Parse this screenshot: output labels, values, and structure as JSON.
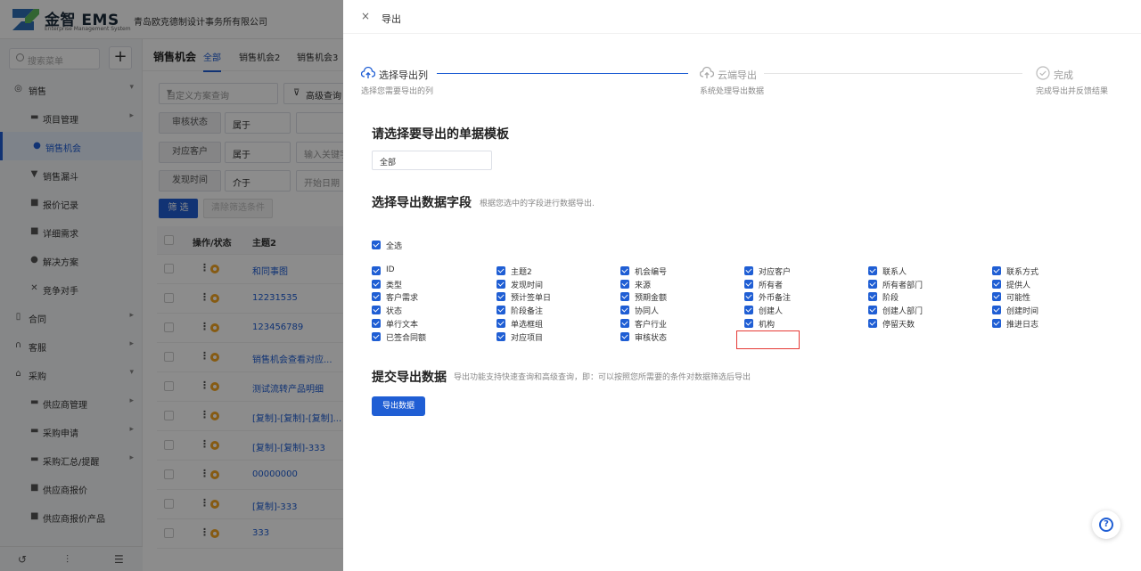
{
  "app": {
    "brand": "金智 EMS",
    "brand_sub": "Enterprise Management System",
    "company": "青岛欧克德制设计事务所有限公司"
  },
  "sidebar": {
    "search_placeholder": "搜索菜单",
    "plus": "+",
    "items": [
      {
        "label": "销售"
      },
      {
        "label": "项目管理"
      },
      {
        "label": "销售机会"
      },
      {
        "label": "销售漏斗"
      },
      {
        "label": "报价记录"
      },
      {
        "label": "详细需求"
      },
      {
        "label": "解决方案"
      },
      {
        "label": "竞争对手"
      },
      {
        "label": "合同"
      },
      {
        "label": "客服"
      },
      {
        "label": "采购"
      },
      {
        "label": "供应商管理"
      },
      {
        "label": "采购申请"
      },
      {
        "label": "采购汇总/提醒"
      },
      {
        "label": "供应商报价"
      },
      {
        "label": "供应商报价产品"
      }
    ]
  },
  "main": {
    "page_title": "销售机会",
    "tabs": [
      "全部",
      "销售机会2",
      "销售机会3"
    ],
    "scheme_placeholder": "自定义方案查询",
    "advanced_query": "高级查询",
    "filters": [
      {
        "label": "审核状态",
        "op": "属于",
        "value": ""
      },
      {
        "label": "对应客户",
        "op": "属于",
        "value": "输入关键字"
      },
      {
        "label": "发现时间",
        "op": "介于",
        "value": "开始日期"
      }
    ],
    "filter_button": "筛 选",
    "clear_button": "清除筛选条件",
    "table_headers": [
      "操作/状态",
      "主题2"
    ],
    "rows": [
      "和同事图",
      "12231535",
      "123456789",
      "销售机会查看对应...",
      "测试流转产品明细",
      "[复制]-[复制]-[复制]...",
      "[复制]-[复制]-333",
      "00000000",
      "[复制]-333",
      "333"
    ]
  },
  "drawer": {
    "close": "×",
    "title": "导出",
    "steps": [
      {
        "title": "选择导出列",
        "desc": "选择您需要导出的列"
      },
      {
        "title": "云端导出",
        "desc": "系统处理导出数据"
      },
      {
        "title": "完成",
        "desc": "完成导出并反馈结果"
      }
    ],
    "template_section_title": "请选择要导出的单据模板",
    "template_value": "全部",
    "fields_section_title": "选择导出数据字段",
    "fields_section_desc": "根据您选中的字段进行数据导出.",
    "select_all": "全选",
    "fields": [
      [
        "ID",
        "类型",
        "客户需求",
        "状态",
        "单行文本",
        "已签合同额"
      ],
      [
        "主题2",
        "发现时间",
        "预计签单日",
        "阶段备注",
        "单选框组",
        "对应项目"
      ],
      [
        "机会编号",
        "来源",
        "预期金额",
        "协同人",
        "客户行业",
        "审核状态"
      ],
      [
        "对应客户",
        "所有者",
        "外币备注",
        "创建人",
        "机构"
      ],
      [
        "联系人",
        "所有者部门",
        "阶段",
        "创建人部门",
        "停留天数"
      ],
      [
        "联系方式",
        "提供人",
        "可能性",
        "创建时间",
        "推进日志"
      ]
    ],
    "submit_section_title": "提交导出数据",
    "submit_section_desc": "导出功能支持快速查询和高级查询，即：可以按照您所需要的条件对数据筛选后导出",
    "export_button": "导出数据",
    "help": "?"
  },
  "colors": {
    "primary": "#1f5ed4",
    "highlight": "#e53935",
    "orange": "#f5a623"
  }
}
